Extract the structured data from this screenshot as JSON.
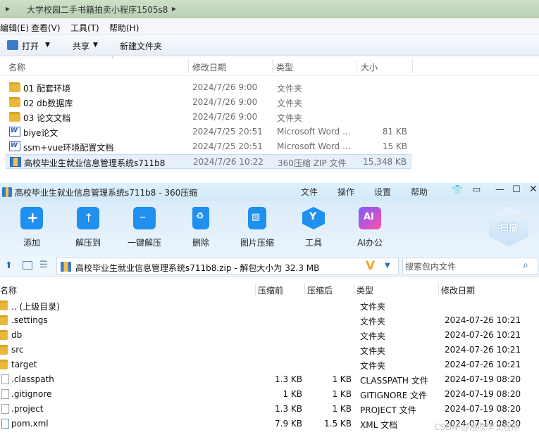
{
  "explorer": {
    "breadcrumb": "大学校园二手书籍拍卖小程序1505s8",
    "menu": [
      "编辑(E)",
      "查看(V)",
      "工具(T)",
      "帮助(H)"
    ],
    "toolbar": {
      "open": "打开",
      "share": "共享",
      "new_folder": "新建文件夹"
    },
    "columns": {
      "name": "名称",
      "date": "修改日期",
      "type": "类型",
      "size": "大小"
    },
    "files": [
      {
        "name": "01 配套环境",
        "date": "2024/7/26 9:00",
        "type": "文件夹",
        "size": "",
        "icon": "folder-icon"
      },
      {
        "name": "02 db数据库",
        "date": "2024/7/26 9:00",
        "type": "文件夹",
        "size": "",
        "icon": "folder-icon"
      },
      {
        "name": "03 论文文档",
        "date": "2024/7/26 9:00",
        "type": "文件夹",
        "size": "",
        "icon": "folder-icon"
      },
      {
        "name": "biye论文",
        "date": "2024/7/25 20:51",
        "type": "Microsoft Word ...",
        "size": "81 KB",
        "icon": "word-doc-icon"
      },
      {
        "name": "ssm+vue环境配置文档",
        "date": "2024/7/25 20:51",
        "type": "Microsoft Word ...",
        "size": "15 KB",
        "icon": "word-doc-icon"
      },
      {
        "name": "高校毕业生就业信息管理系统s711b8",
        "date": "2024/7/26 10:22",
        "type": "360压缩 ZIP 文件",
        "size": "15,348 KB",
        "icon": "zip-archive-icon"
      }
    ]
  },
  "zip": {
    "title": "高校毕业生就业信息管理系统s711b8 - 360压缩",
    "title_menu": [
      "文件",
      "操作",
      "设置",
      "帮助"
    ],
    "tools": [
      "添加",
      "解压到",
      "一键解压",
      "删除",
      "图片压缩",
      "工具",
      "AI办公"
    ],
    "scan_label": "扫描",
    "path_text": "高校毕业生就业信息管理系统s711b8.zip - 解包大小为 32.3 MB",
    "search_placeholder": "搜索包内文件",
    "columns": {
      "name": "名称",
      "compressed": "压缩前",
      "packed": "压缩后",
      "type": "类型",
      "date": "修改日期"
    },
    "files": [
      {
        "name": ".. (上级目录)",
        "csize": "",
        "osize": "",
        "type": "文件夹",
        "date": "",
        "icon": "folder-icon"
      },
      {
        "name": ".settings",
        "csize": "",
        "osize": "",
        "type": "文件夹",
        "date": "2024-07-26 10:21",
        "icon": "folder-icon"
      },
      {
        "name": "db",
        "csize": "",
        "osize": "",
        "type": "文件夹",
        "date": "2024-07-26 10:21",
        "icon": "folder-icon"
      },
      {
        "name": "src",
        "csize": "",
        "osize": "",
        "type": "文件夹",
        "date": "2024-07-26 10:21",
        "icon": "folder-icon"
      },
      {
        "name": "target",
        "csize": "",
        "osize": "",
        "type": "文件夹",
        "date": "2024-07-26 10:21",
        "icon": "folder-icon"
      },
      {
        "name": ".classpath",
        "csize": "1.3 KB",
        "osize": "1 KB",
        "type": "CLASSPATH 文件",
        "date": "2024-07-19 08:20",
        "icon": "file-icon"
      },
      {
        "name": ".gitignore",
        "csize": "1 KB",
        "osize": "1 KB",
        "type": "GITIGNORE 文件",
        "date": "2024-07-19 08:20",
        "icon": "file-icon"
      },
      {
        "name": ".project",
        "csize": "1.3 KB",
        "osize": "1 KB",
        "type": "PROJECT 文件",
        "date": "2024-07-19 08:20",
        "icon": "file-icon"
      },
      {
        "name": "pom.xml",
        "csize": "7.9 KB",
        "osize": "1.5 KB",
        "type": "XML 文档",
        "date": "2024-07-19 08:20",
        "icon": "xml-file-icon"
      }
    ],
    "watermark": "CSDN @港吹学长程序"
  }
}
